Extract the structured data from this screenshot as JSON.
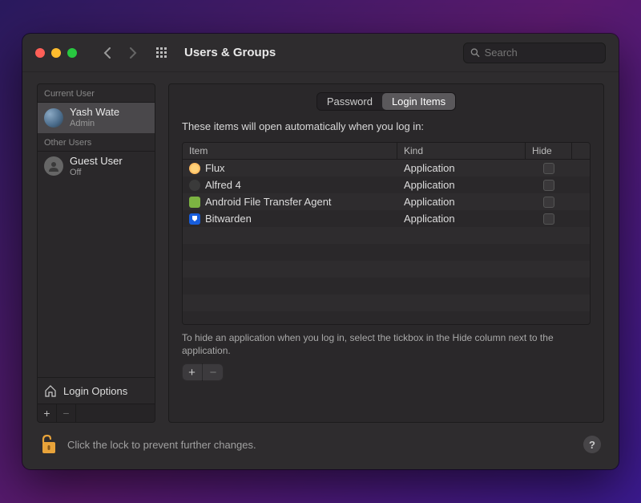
{
  "window": {
    "title": "Users & Groups",
    "search_placeholder": "Search"
  },
  "sidebar": {
    "current_header": "Current User",
    "other_header": "Other Users",
    "current": {
      "name": "Yash Wate",
      "role": "Admin"
    },
    "others": [
      {
        "name": "Guest User",
        "role": "Off"
      }
    ],
    "login_options": "Login Options"
  },
  "tabs": {
    "password": "Password",
    "login_items": "Login Items",
    "active": "login_items"
  },
  "main": {
    "description": "These items will open automatically when you log in:",
    "columns": {
      "item": "Item",
      "kind": "Kind",
      "hide": "Hide"
    },
    "rows": [
      {
        "name": "Flux",
        "kind": "Application",
        "hide": false,
        "icon": "flux"
      },
      {
        "name": "Alfred 4",
        "kind": "Application",
        "hide": false,
        "icon": "alfred"
      },
      {
        "name": "Android File Transfer Agent",
        "kind": "Application",
        "hide": false,
        "icon": "android"
      },
      {
        "name": "Bitwarden",
        "kind": "Application",
        "hide": false,
        "icon": "bitwarden"
      }
    ],
    "hint": "To hide an application when you log in, select the tickbox in the Hide column next to the application."
  },
  "lock": {
    "text": "Click the lock to prevent further changes."
  }
}
